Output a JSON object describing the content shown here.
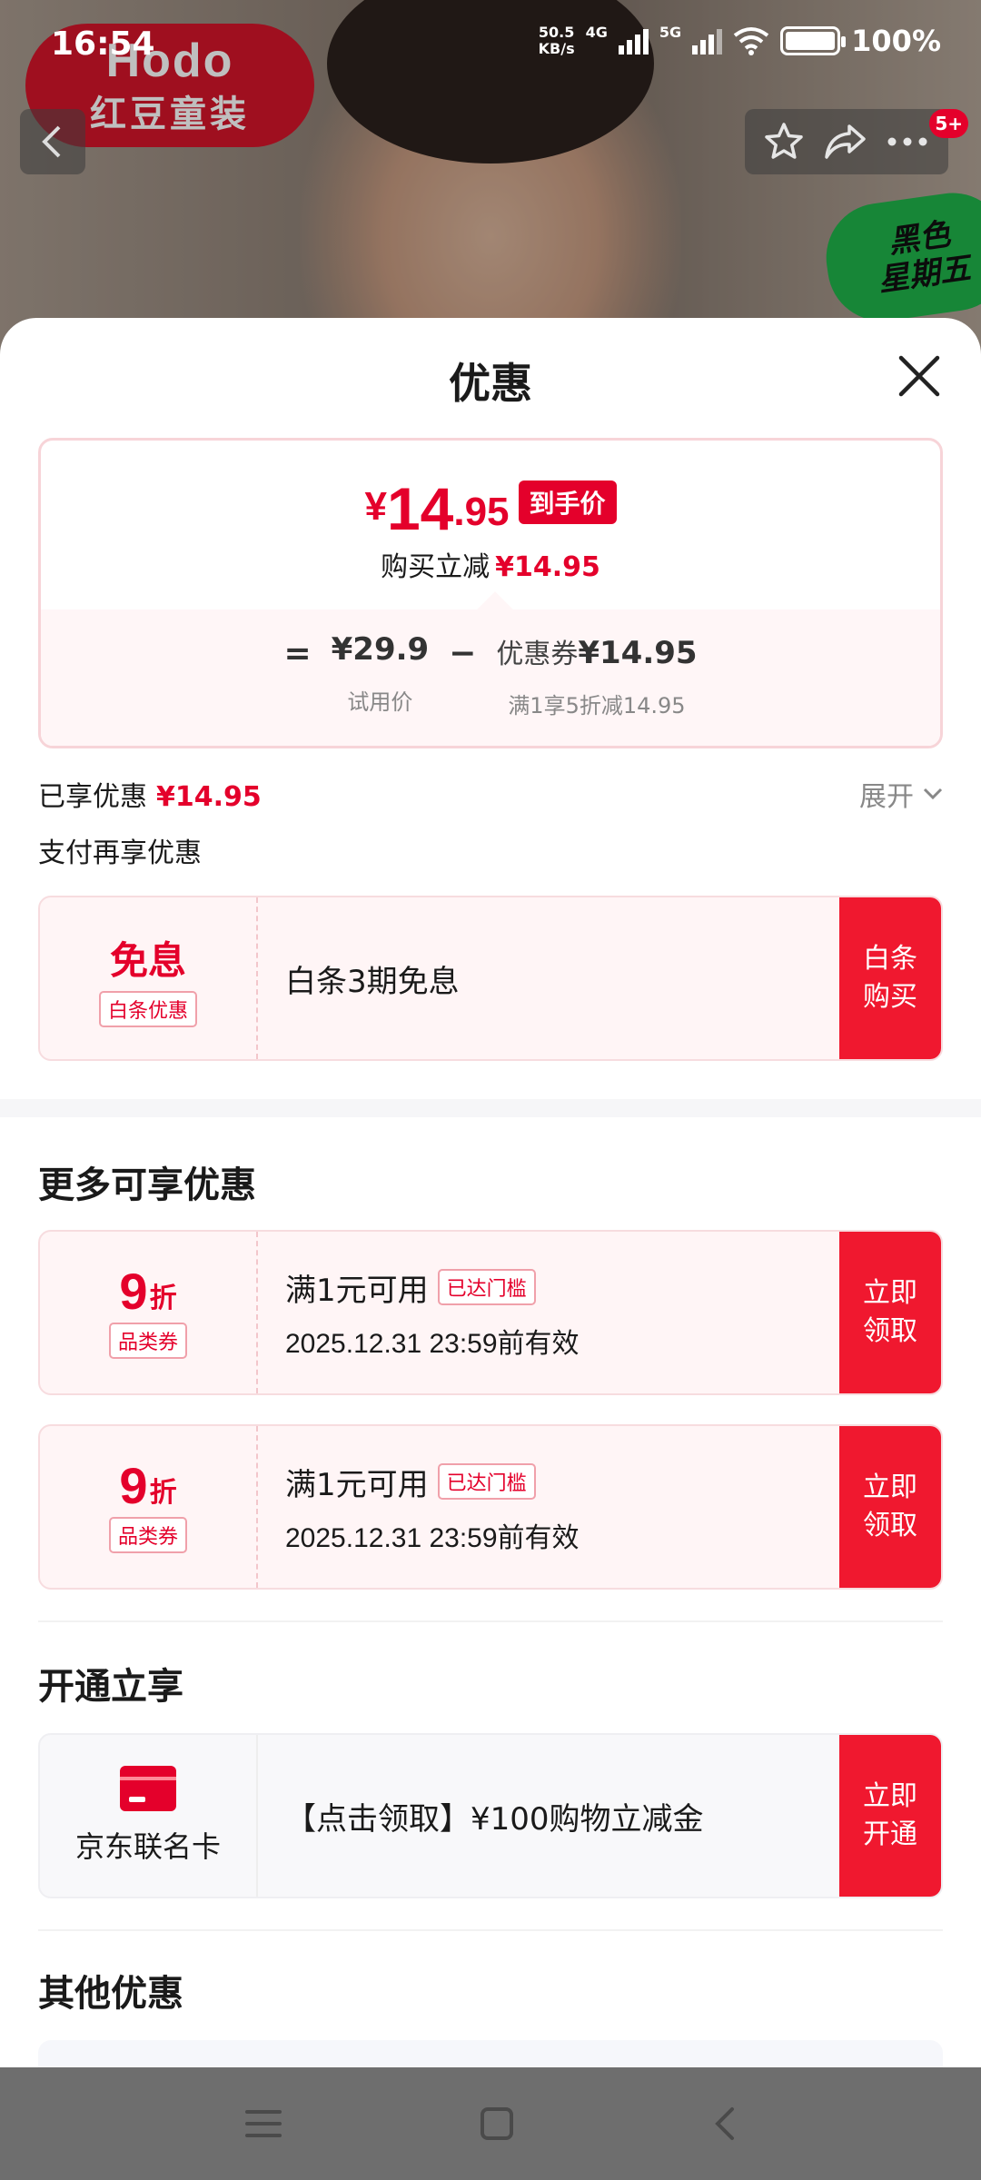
{
  "status_bar": {
    "time": "16:54",
    "net_speed_top": "50.5",
    "net_speed_bottom": "KB/s",
    "sig1_tag": "4G",
    "sig2_tag": "5G",
    "battery": "100%"
  },
  "background": {
    "brand_en": "Hodo",
    "brand_cn": "红豆童装",
    "promo_line1": "黑色",
    "promo_line2": "星期五",
    "badge_count": "5+"
  },
  "sheet": {
    "title": "优惠",
    "price": {
      "currency": "¥",
      "integer": "14",
      "decimal": ".95",
      "tag": "到手价",
      "sub_label": "购买立减",
      "sub_value": "¥14.95"
    },
    "formula": {
      "eq": "=",
      "base_value": "¥29.9",
      "base_caption": "试用价",
      "minus": "−",
      "coupon_label": "优惠券",
      "coupon_value": "¥14.95",
      "coupon_caption": "满1享5折减14.95"
    },
    "enjoyed_label": "已享优惠",
    "enjoyed_value": "¥14.95",
    "expand_label": "展开",
    "pay_more_label": "支付再享优惠",
    "baitiao": {
      "left_title": "免息",
      "left_tag": "白条优惠",
      "text": "白条3期免息",
      "button": "白条购买"
    },
    "more_title": "更多可享优惠",
    "coupons": [
      {
        "discount": "9",
        "unit": "折",
        "type": "品类券",
        "title": "满1元可用",
        "status": "已达门槛",
        "expiry": "2025.12.31 23:59前有效",
        "button": "立即领取"
      },
      {
        "discount": "9",
        "unit": "折",
        "type": "品类券",
        "title": "满1元可用",
        "status": "已达门槛",
        "expiry": "2025.12.31 23:59前有效",
        "button": "立即领取"
      }
    ],
    "open_title": "开通立享",
    "card": {
      "name": "京东联名卡",
      "text": "【点击领取】¥100购物立减金",
      "button": "立即开通"
    },
    "other_title": "其他优惠"
  },
  "colors": {
    "accent": "#e4002b",
    "button_red": "#f0182f",
    "coupon_bg": "#fff5f6"
  },
  "icons": [
    "back-arrow-icon",
    "star-icon",
    "share-icon",
    "more-icon",
    "close-icon",
    "chevron-down-icon",
    "credit-card-icon",
    "menu-icon",
    "home-square-icon",
    "nav-back-icon"
  ]
}
